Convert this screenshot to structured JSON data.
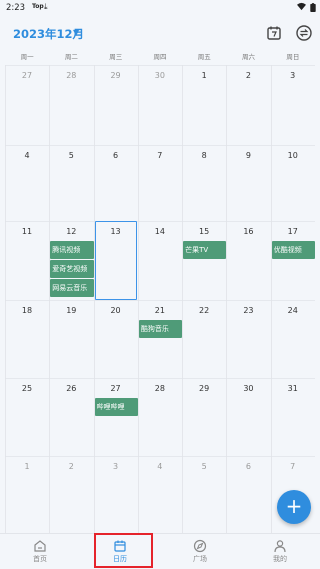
{
  "status": {
    "time": "2:23",
    "label": "Top",
    "download": "⤓"
  },
  "header": {
    "month_title": "2023年12月",
    "caret": "▼"
  },
  "weekdays": [
    "周一",
    "周二",
    "周三",
    "周四",
    "周五",
    "周六",
    "周日"
  ],
  "weeks": [
    [
      {
        "d": "27",
        "o": true
      },
      {
        "d": "28",
        "o": true
      },
      {
        "d": "29",
        "o": true
      },
      {
        "d": "30",
        "o": true
      },
      {
        "d": "1"
      },
      {
        "d": "2"
      },
      {
        "d": "3"
      }
    ],
    [
      {
        "d": "4"
      },
      {
        "d": "5"
      },
      {
        "d": "6"
      },
      {
        "d": "7"
      },
      {
        "d": "8"
      },
      {
        "d": "9"
      },
      {
        "d": "10"
      }
    ],
    [
      {
        "d": "11"
      },
      {
        "d": "12"
      },
      {
        "d": "13"
      },
      {
        "d": "14"
      },
      {
        "d": "15"
      },
      {
        "d": "16"
      },
      {
        "d": "17"
      }
    ],
    [
      {
        "d": "18"
      },
      {
        "d": "19"
      },
      {
        "d": "20"
      },
      {
        "d": "21"
      },
      {
        "d": "22"
      },
      {
        "d": "23"
      },
      {
        "d": "24"
      }
    ],
    [
      {
        "d": "25"
      },
      {
        "d": "26"
      },
      {
        "d": "27"
      },
      {
        "d": "28"
      },
      {
        "d": "29"
      },
      {
        "d": "30"
      },
      {
        "d": "31"
      }
    ],
    [
      {
        "d": "1",
        "o": true
      },
      {
        "d": "2",
        "o": true
      },
      {
        "d": "3",
        "o": true
      },
      {
        "d": "4",
        "o": true
      },
      {
        "d": "5",
        "o": true
      },
      {
        "d": "6",
        "o": true
      },
      {
        "d": "7",
        "o": true
      }
    ]
  ],
  "today": {
    "week": 2,
    "col": 2,
    "day": "13"
  },
  "events": [
    {
      "label": "腾讯视频",
      "week": 2,
      "col": 1,
      "slot": 0
    },
    {
      "label": "爱奇艺视频",
      "week": 2,
      "col": 1,
      "slot": 1
    },
    {
      "label": "网易云音乐",
      "week": 2,
      "col": 1,
      "slot": 2
    },
    {
      "label": "芒果TV",
      "week": 2,
      "col": 4,
      "slot": 0
    },
    {
      "label": "优酷视频",
      "week": 2,
      "col": 6,
      "slot": 0
    },
    {
      "label": "酷狗音乐",
      "week": 3,
      "col": 3,
      "slot": 0
    },
    {
      "label": "哔哩哔哩",
      "week": 4,
      "col": 2,
      "slot": 0
    }
  ],
  "fab": {
    "label": "+"
  },
  "nav": [
    {
      "label": "首页",
      "icon": "home-icon",
      "active": false
    },
    {
      "label": "日历",
      "icon": "calendar-icon",
      "active": true
    },
    {
      "label": "广场",
      "icon": "compass-icon",
      "active": false
    },
    {
      "label": "我的",
      "icon": "person-icon",
      "active": false
    }
  ],
  "colors": {
    "accent": "#2f8dde",
    "event": "#4f9b78",
    "highlight": "#e5232b",
    "today_border": "#3c93e8"
  }
}
